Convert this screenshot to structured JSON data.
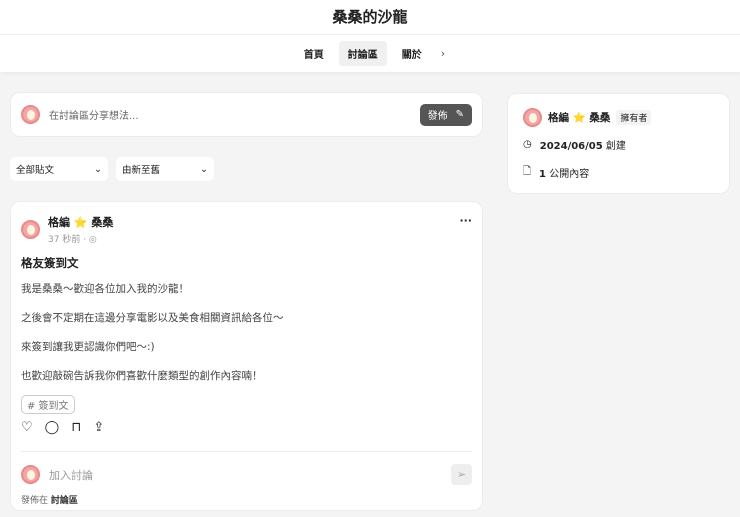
{
  "header": {
    "title": "桑桑的沙龍"
  },
  "nav": {
    "tabs": [
      "首頁",
      "討論區",
      "關於"
    ],
    "active": "討論區"
  },
  "composer": {
    "placeholder": "在討論區分享想法...",
    "publish": "發佈"
  },
  "filters": {
    "type": "全部貼文",
    "sort": "由新至舊"
  },
  "post": {
    "author_prefix": "格編",
    "author_name": "桑桑",
    "time": "37 秒前",
    "title": "格友簽到文",
    "paragraphs": [
      "我是桑桑～歡迎各位加入我的沙龍！",
      "之後會不定期在這邊分享電影以及美食相關資訊給各位～",
      "來簽到讓我更認識你們吧～:)",
      "也歡迎敲碗告訴我你們喜歡什麼類型的創作內容喃！"
    ],
    "tag": "# 簽到文",
    "reply_placeholder": "加入討論",
    "posted_in_label": "發佈在",
    "posted_in": "討論區"
  },
  "sidebar": {
    "owner_prefix": "格編",
    "owner_name": "桑桑",
    "badge": "擁有者",
    "created_date": "2024/06/05",
    "created_label": "創建",
    "public_count": "1",
    "public_label": "公開內容"
  }
}
